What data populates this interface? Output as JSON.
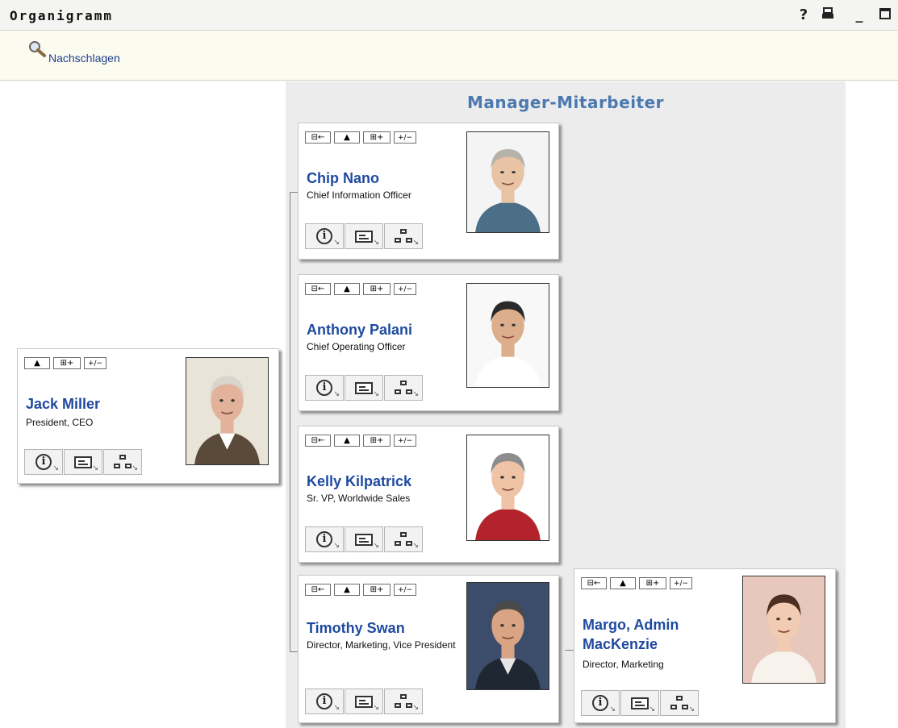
{
  "window": {
    "title": "Organigramm",
    "controls": {
      "help": "?",
      "print": "▤",
      "minimize": "_",
      "maximize": "□"
    }
  },
  "toolbar": {
    "lookup_label": "Nachschlagen"
  },
  "chart": {
    "title": "Manager-Mitarbeiter"
  },
  "action_labels": {
    "upline": "⊟←",
    "up": "▲",
    "downline": "⊞+",
    "toggle": "+/−"
  },
  "button_names": [
    "info",
    "contact",
    "orgchart"
  ],
  "people": {
    "root": {
      "name": "Jack Miller",
      "title": "President, CEO",
      "photo": {
        "bg": "#e9e4d8",
        "skin": "#e2b39a",
        "hair": "#d9d4cc",
        "suit": "#5a4a3a",
        "shirt": "#ffffff"
      }
    },
    "chip": {
      "name": "Chip Nano",
      "title": "Chief Information Officer",
      "photo": {
        "bg": "#f4f4f4",
        "skin": "#e8c3a4",
        "hair": "#b7b2a8",
        "suit": "#4a6f86",
        "shirt": "#4a6f86"
      }
    },
    "anthony": {
      "name": "Anthony Palani",
      "title": "Chief Operating Officer",
      "photo": {
        "bg": "#f8f8f8",
        "skin": "#dcae8c",
        "hair": "#2a2a2a",
        "suit": "#ffffff",
        "shirt": "#ffffff"
      }
    },
    "kelly": {
      "name": "Kelly Kilpatrick",
      "title": "Sr. VP, Worldwide Sales",
      "photo": {
        "bg": "#ffffff",
        "skin": "#efc3a6",
        "hair": "#8d8d8d",
        "suit": "#b3232c",
        "shirt": "#b3232c"
      }
    },
    "timothy": {
      "name": "Timothy Swan",
      "title": "Director, Marketing, Vice President",
      "photo": {
        "bg": "#3b4d6b",
        "skin": "#d9a483",
        "hair": "#4a4a4a",
        "suit": "#1f2732",
        "shirt": "#e6e6e6"
      }
    },
    "margo": {
      "name": "Margo, Admin MacKenzie",
      "title": "Director, Marketing",
      "photo": {
        "bg": "#e8c8bd",
        "skin": "#f1cbb2",
        "hair": "#4a2f22",
        "suit": "#f7f2ec",
        "shirt": "#f7f2ec"
      }
    }
  }
}
